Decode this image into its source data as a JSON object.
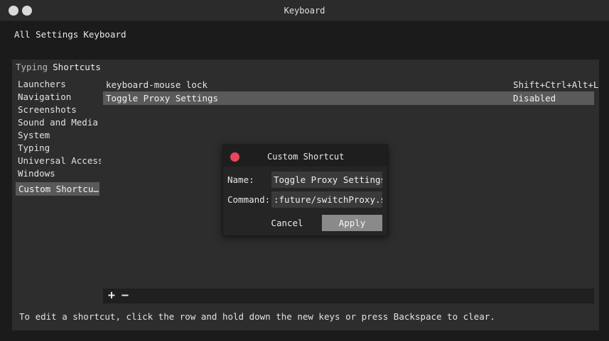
{
  "window": {
    "title": "Keyboard"
  },
  "breadcrumb": [
    "All Settings",
    "Keyboard"
  ],
  "tabs": [
    {
      "label": "Typing",
      "active": false
    },
    {
      "label": "Shortcuts",
      "active": true
    }
  ],
  "sidebar": {
    "items": [
      {
        "label": "Launchers"
      },
      {
        "label": "Navigation"
      },
      {
        "label": "Screenshots"
      },
      {
        "label": "Sound and Media"
      },
      {
        "label": "System"
      },
      {
        "label": "Typing"
      },
      {
        "label": "Universal Access"
      },
      {
        "label": "Windows"
      },
      {
        "label": "Custom Shortcu…",
        "selected": true
      }
    ]
  },
  "shortcuts": {
    "rows": [
      {
        "name": "keyboard-mouse lock",
        "keys": "Shift+Ctrl+Alt+L",
        "selected": false
      },
      {
        "name": "Toggle Proxy Settings",
        "keys": "Disabled",
        "selected": true
      }
    ],
    "add_label": "+",
    "remove_label": "−"
  },
  "hint": "To edit a shortcut, click the row and hold down the new keys or press Backspace to clear.",
  "dialog": {
    "title": "Custom Shortcut",
    "name_label": "Name:",
    "name_value": "Toggle Proxy Settings",
    "command_label": "Command:",
    "command_value": ":future/switchProxy.sh",
    "cancel_label": "Cancel",
    "apply_label": "Apply"
  },
  "colors": {
    "close_button": "#e8475a",
    "selection": "#5a5a5a",
    "apply_button": "#8a8a8a"
  }
}
